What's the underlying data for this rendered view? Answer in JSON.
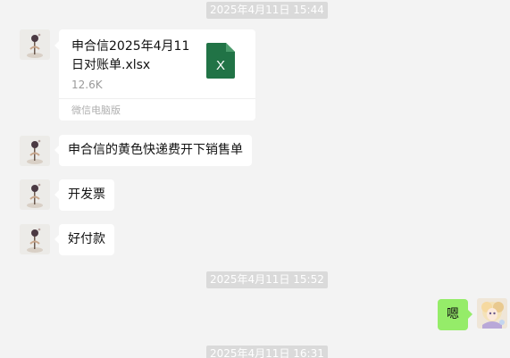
{
  "timestamps": [
    "2025年4月11日 15:44",
    "2025年4月11日 15:52",
    "2025年4月11日 16:31"
  ],
  "file_message": {
    "file_name": "申合信2025年4月11日对账单.xlsx",
    "file_size": "12.6K",
    "source": "微信电脑版",
    "icon_letter": "X",
    "icon_color": "#217346"
  },
  "messages": [
    {
      "text": "申合信的黄色快递费开下销售单"
    },
    {
      "text": "开发票"
    },
    {
      "text": "好付款"
    }
  ],
  "reply": {
    "text": "嗯"
  },
  "colors": {
    "background": "#f3f3f3",
    "bubble_left": "#ffffff",
    "bubble_right": "#95ec69"
  }
}
